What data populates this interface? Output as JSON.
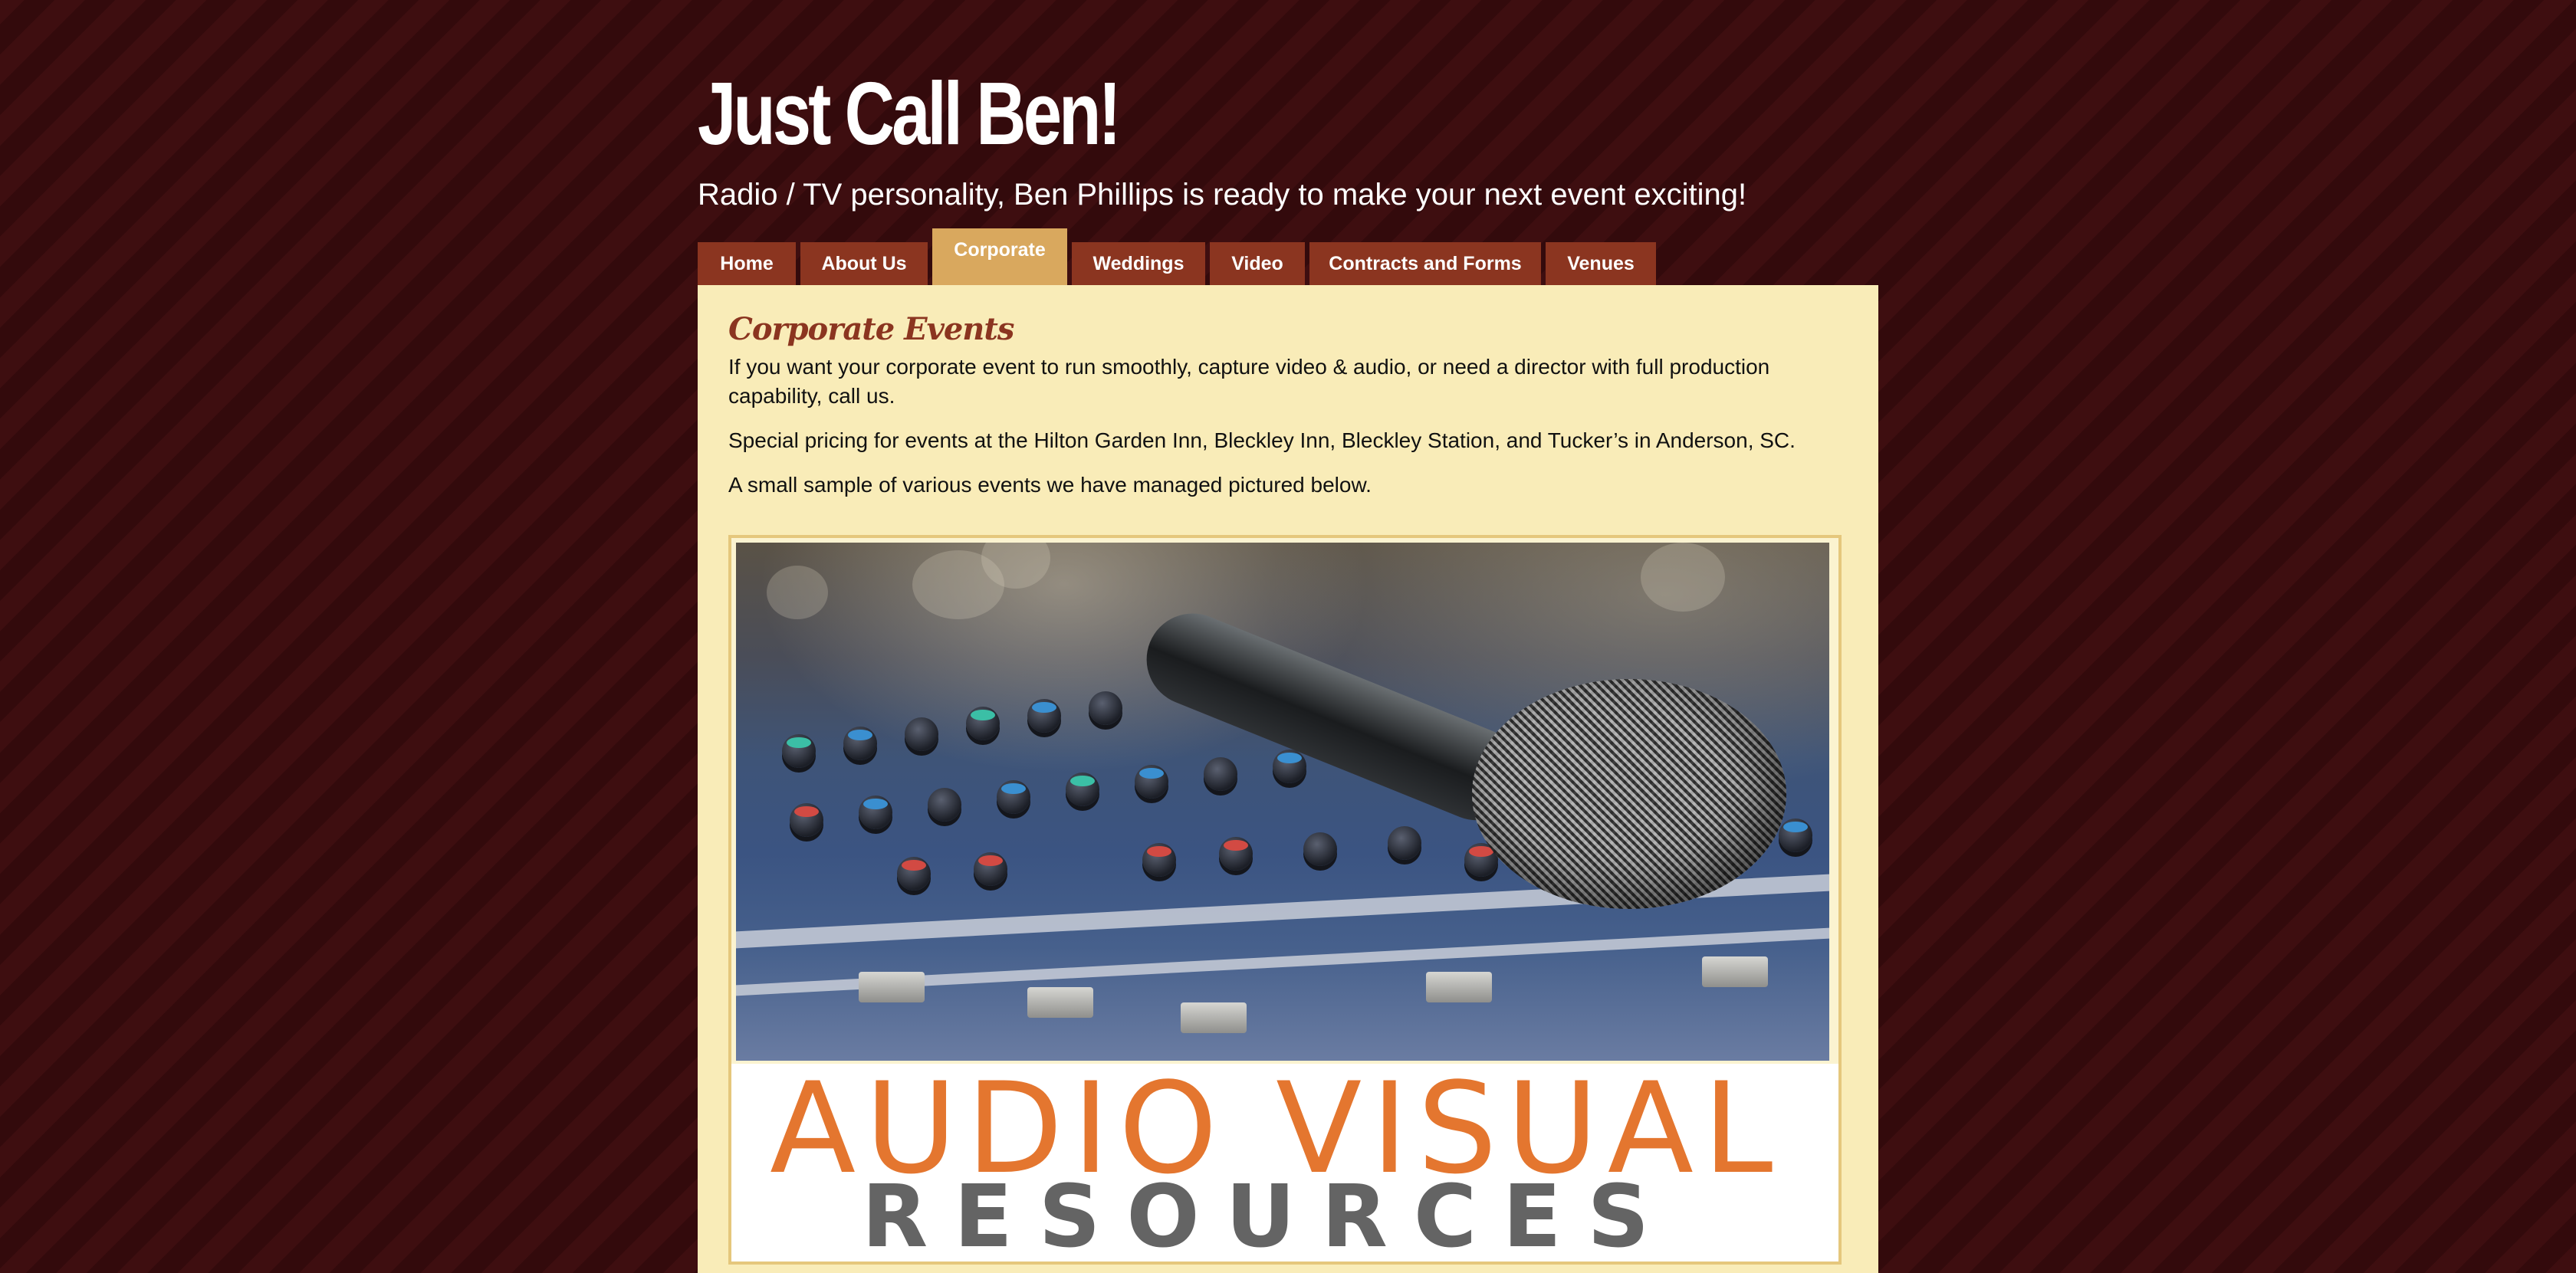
{
  "site": {
    "title": "Just Call Ben!",
    "tagline": "Radio / TV personality, Ben Phillips is ready to make your next event exciting!"
  },
  "nav": {
    "active": "Corporate",
    "items": [
      {
        "label": "Home"
      },
      {
        "label": "About Us"
      },
      {
        "label": "Corporate"
      },
      {
        "label": "Weddings"
      },
      {
        "label": "Video"
      },
      {
        "label": "Contracts and Forms"
      },
      {
        "label": "Venues"
      }
    ]
  },
  "content": {
    "heading": "Corporate Events",
    "paragraphs": [
      "If you want your corporate event to run smoothly, capture video & audio, or need a director with full production capability, call us.",
      "Special pricing for events at the Hilton Garden Inn, Bleckley Inn, Bleckley Station, and Tucker’s in Anderson, SC.",
      "A small sample of various events we have managed pictured below."
    ],
    "image": {
      "logo_line1": "AUDIO VISUAL",
      "logo_line2": "RESOURCES"
    }
  },
  "colors": {
    "background": "#3b0d0f",
    "tab": "#8b3520",
    "tab_active": "#d9a85e",
    "content_bg": "#f9ecb8",
    "heading": "#8b3520",
    "logo_orange": "#e4762f",
    "logo_gray": "#646464"
  }
}
